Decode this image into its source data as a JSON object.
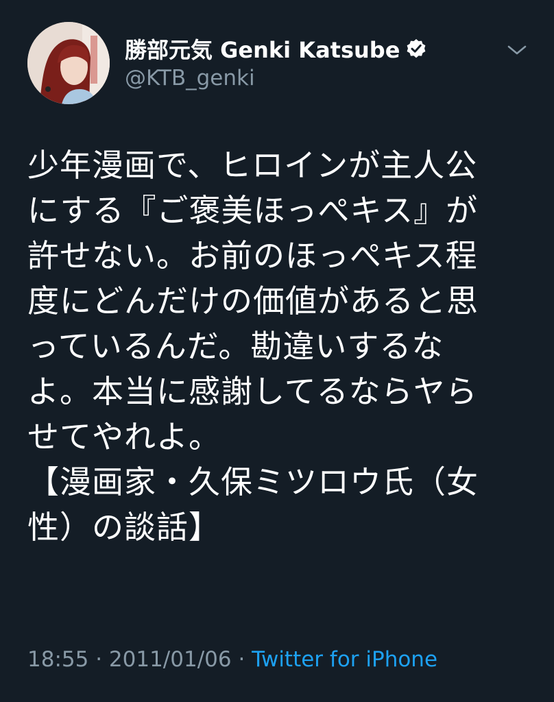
{
  "user": {
    "display_name": "勝部元気 Genki Katsube",
    "handle": "@KTB_genki",
    "verified": true
  },
  "tweet": {
    "lines": [
      "少年漫画で、ヒロインが主人公",
      "にする『ご褒美ほっぺキス』が",
      "許せない。お前のほっぺキス程",
      "度にどんだけの価値があると思",
      "っているんだ。勘違いするな",
      "よ。本当に感謝してるならヤら",
      "せてやれよ。",
      "【漫画家・久保ミツロウ氏（女",
      "性）の談話】"
    ],
    "time": "18:55",
    "separator": " · ",
    "date": "2011/01/06",
    "source": "Twitter for iPhone"
  },
  "colors": {
    "background": "#141d26",
    "text": "#ffffff",
    "muted": "#8899a6",
    "link": "#1da1f2"
  },
  "icons": {
    "verified": "verified-badge-icon",
    "caret": "chevron-down-icon"
  }
}
